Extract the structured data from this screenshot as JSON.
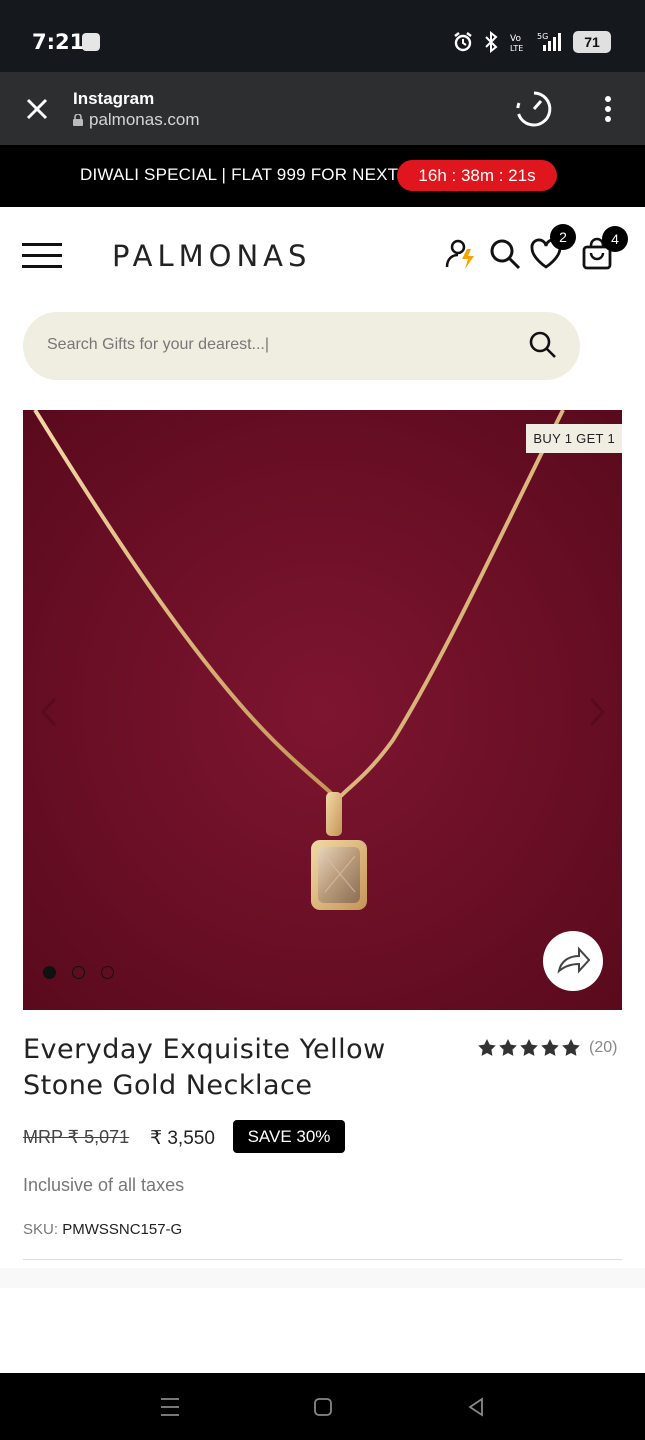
{
  "status": {
    "time": "7:21",
    "battery": "71"
  },
  "browser": {
    "title": "Instagram",
    "url": "palmonas.com"
  },
  "promo": {
    "text": "DIWALI SPECIAL | FLAT 999 FOR NEXT :",
    "timer": "16h : 38m : 21s"
  },
  "header": {
    "logo": "PALMONAS",
    "wishlist_count": "2",
    "cart_count": "4"
  },
  "search": {
    "placeholder": "Search Gifts for your dearest...|"
  },
  "gallery": {
    "tag": "BUY 1 GET 1",
    "slides": 3,
    "active_slide": 1
  },
  "product": {
    "title": "Everyday Exquisite Yellow Stone Gold Necklace",
    "rating": 5,
    "rating_count": "(20)",
    "mrp": "MRP  ₹ 5,071",
    "price": "₹ 3,550",
    "save": "SAVE 30%",
    "taxes": "Inclusive of all taxes",
    "sku_label": "SKU: ",
    "sku_value": "PMWSSNC157-G"
  },
  "colors": {
    "accent": "#e0161e",
    "gallery_bg": "#6b0e24",
    "search_bg": "#f0ede1"
  }
}
